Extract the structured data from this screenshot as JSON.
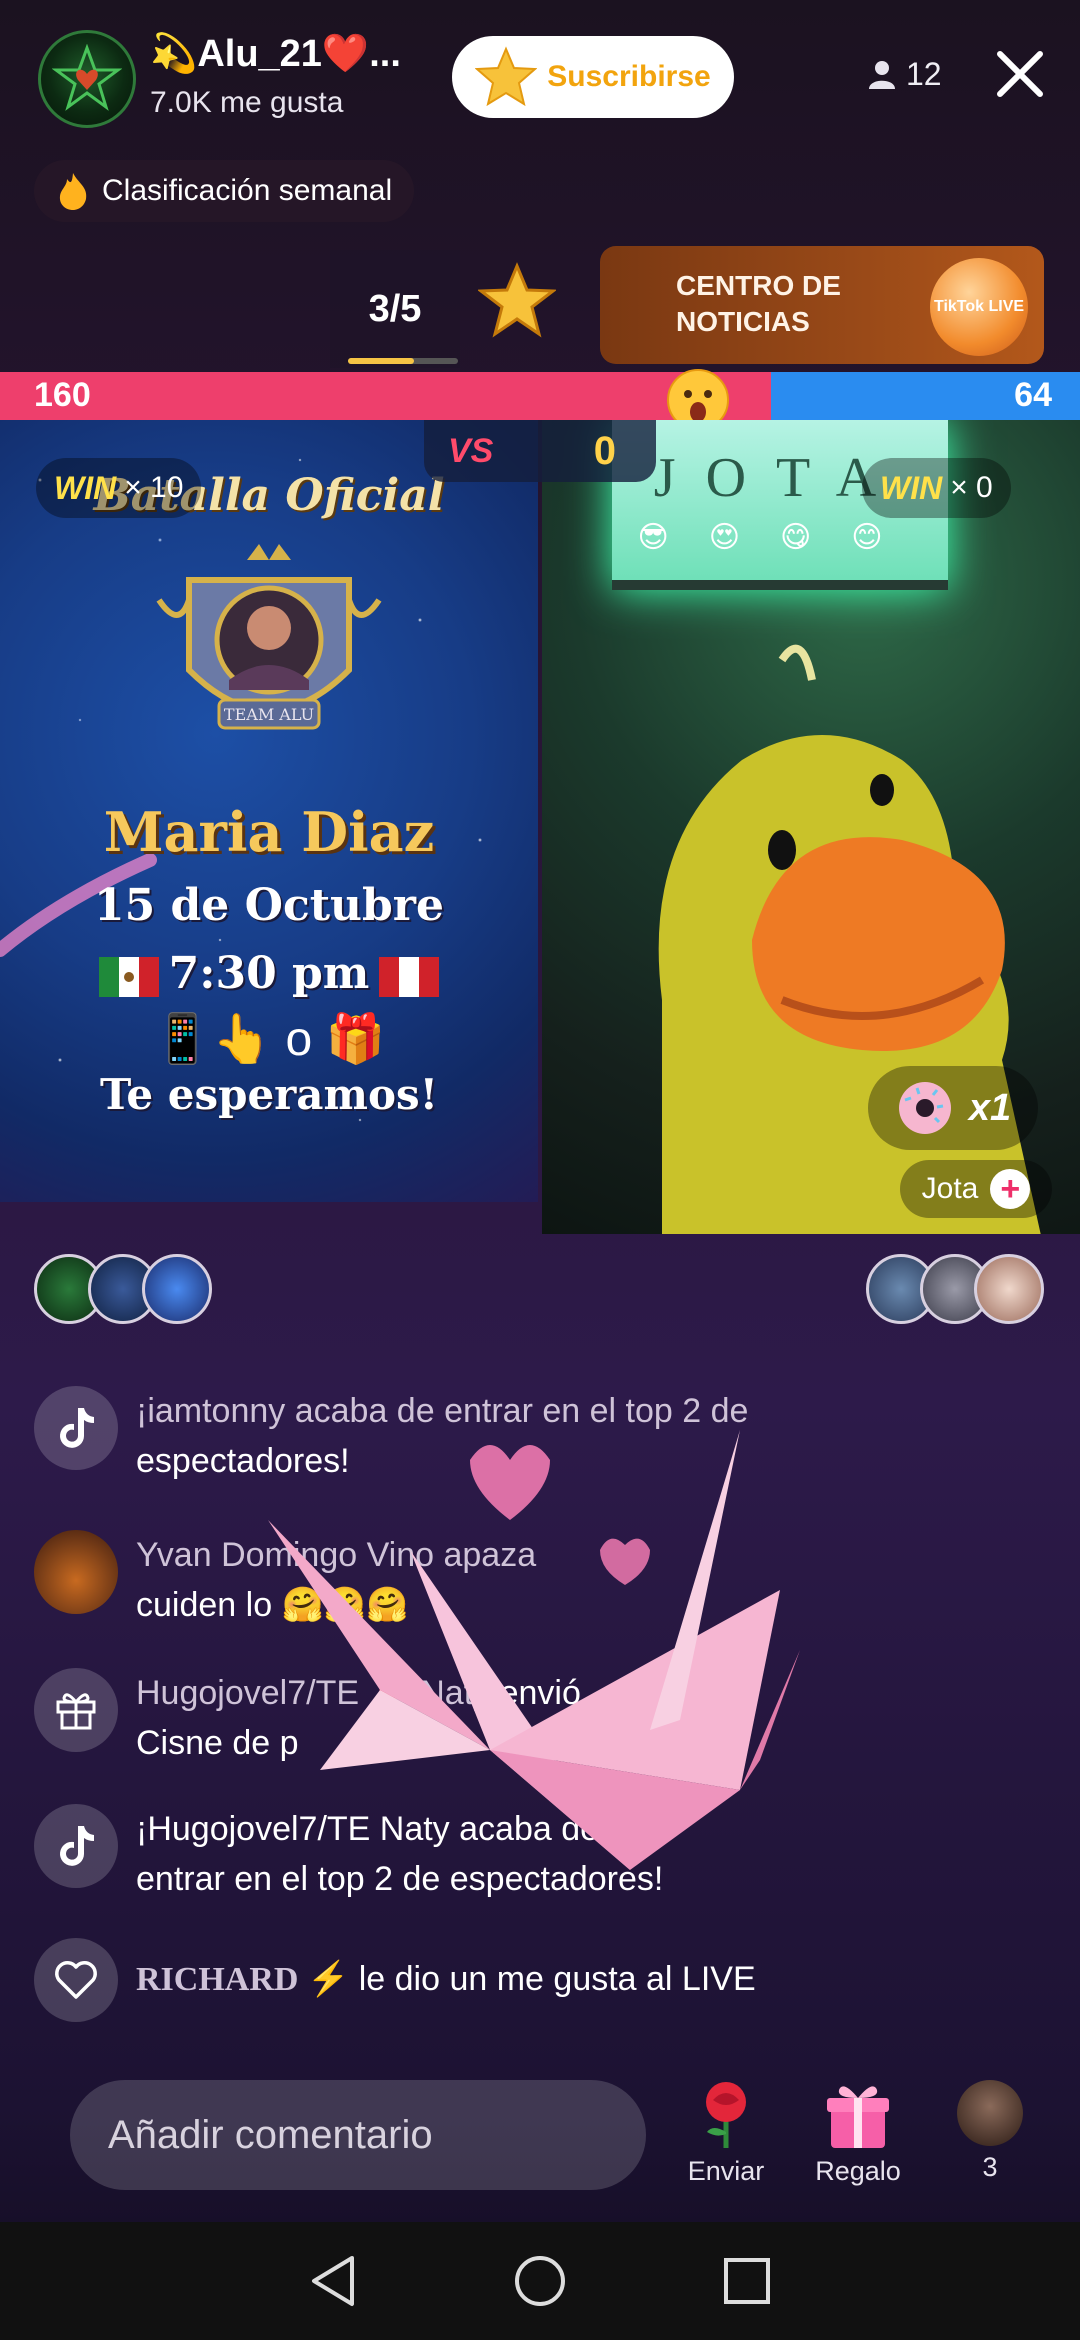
{
  "header": {
    "host_name": "💫Alu_21❤️...",
    "likes": "7.0K me gusta",
    "subscribe_label": "Suscribirse",
    "viewer_count": "12"
  },
  "weekly": {
    "label": "Clasificación semanal"
  },
  "events": {
    "round": "3/5",
    "round_progress": 0.6,
    "news_label": "CENTRO DE NOTICIAS",
    "news_badge": "TikTok LIVE"
  },
  "battle": {
    "left_score": "160",
    "right_score": "64",
    "left_share": 0.714,
    "vs_label": "VS",
    "center_score": "0",
    "left_win": {
      "label": "WIN",
      "count": "× 10"
    },
    "right_win": {
      "label": "WIN",
      "count": "× 0"
    }
  },
  "left_stream": {
    "title": "Batalla Oficial",
    "crest_text": "TEAM ALU",
    "name": "Maria Diaz",
    "date": "15 de Octubre",
    "time": "7:30 pm",
    "icons": "📱👆 o 🎁",
    "welcome": "Te esperamos!"
  },
  "right_stream": {
    "sign_text": "JOTA",
    "gift_count": "x1",
    "name_tag": "Jota"
  },
  "chat": [
    {
      "icon": "tiktok-icon",
      "user": "¡iamtonny acaba de entrar en el top 2 de",
      "message": "espectadores!"
    },
    {
      "icon": "avatar",
      "user": "Yvan Domingo Vino apaza",
      "message": "cuiden lo 🤗🤗🤗"
    },
    {
      "icon": "gift-icon",
      "user": "Hugojovel7/TE 🌹 Naty",
      "action": "envió",
      "message": "Cisne de p"
    },
    {
      "icon": "tiktok-icon",
      "user": "¡Hugojovel7/TE Naty acaba de",
      "message": "entrar en el top 2 de espectadores!"
    },
    {
      "icon": "heart-icon",
      "user": "RICHARD ⚡",
      "message": "le dio un me gusta al LIVE"
    }
  ],
  "bottom": {
    "comment_placeholder": "Añadir comentario",
    "send_label": "Enviar",
    "gift_label": "Regalo",
    "viewers_label": "3"
  },
  "colors": {
    "battle_red": "#ee3f6c",
    "battle_blue": "#2a8cf0",
    "subscribe_text": "#f2a40e",
    "win_yellow": "#ffe14a"
  }
}
